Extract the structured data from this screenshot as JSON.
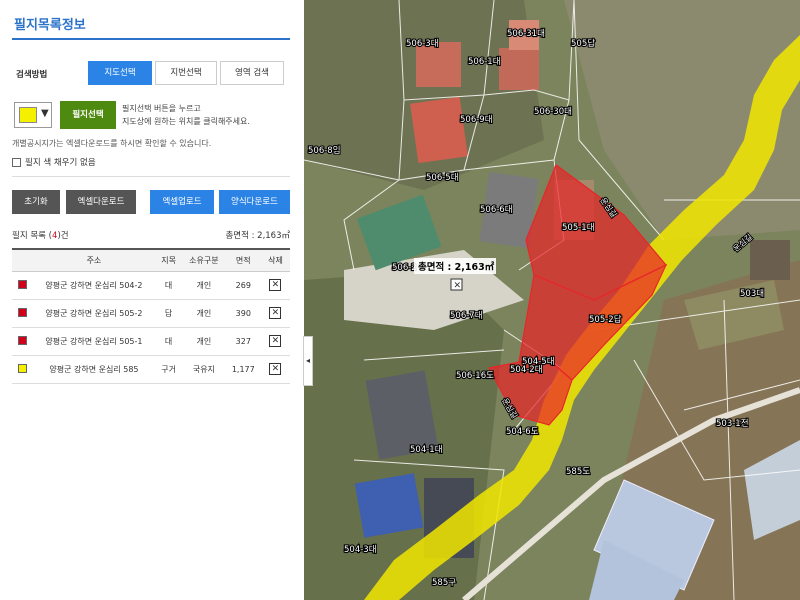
{
  "panel": {
    "title": "필지목록정보",
    "search_label": "검색방법",
    "tabs": [
      "지도선택",
      "지번선택",
      "영역 검색"
    ],
    "select_button": "필지선택",
    "help_line1": "필지선택 버튼을 누르고",
    "help_line2": "지도상에 원하는 위치를 클릭해주세요.",
    "note": "개별공시지가는 엑셀다운로드를 하시면 확인할 수 있습니다.",
    "no_fill_label": "필지 색 채우기 없음",
    "buttons": {
      "reset": "초기화",
      "excel_download": "엑셀다운로드",
      "excel_upload": "엑셀업로드",
      "form_download": "양식다운로드"
    },
    "count_prefix": "필지 목록 (",
    "count_value": "4",
    "count_suffix": ")건",
    "total_area": "총면적 : 2,163㎡",
    "table": {
      "headers": [
        "",
        "주소",
        "지목",
        "소유구분",
        "면적",
        "삭제"
      ],
      "rows": [
        {
          "color": "#d0021b",
          "address": "양평군 강하면 운심리 504-2",
          "category": "대",
          "owner": "개인",
          "area": "269"
        },
        {
          "color": "#d0021b",
          "address": "양평군 강하면 운심리 505-2",
          "category": "답",
          "owner": "개인",
          "area": "390"
        },
        {
          "color": "#d0021b",
          "address": "양평군 강하면 운심리 505-1",
          "category": "대",
          "owner": "개인",
          "area": "327"
        },
        {
          "color": "#f5f000",
          "address": "양평군 강하면 운심리 585",
          "category": "구거",
          "owner": "국유지",
          "area": "1,177"
        }
      ],
      "delete_glyph": "✕"
    },
    "handle_glyph": "◂"
  },
  "map": {
    "total_label": "총면적 : 2,163㎡",
    "parcels": [
      "506-3대",
      "506-31대",
      "506-1대",
      "505답",
      "506-30대",
      "506-9대",
      "506-8임",
      "506-5대",
      "506-6대",
      "505-1대",
      "506-2",
      "506-7대",
      "505-2답",
      "503대",
      "504-5대",
      "506-16도",
      "504-2대",
      "504-6도",
      "504-1대",
      "503-1전",
      "585도",
      "504-3대",
      "585구"
    ],
    "roads": [
      "운심길",
      "운심길",
      "운심길"
    ],
    "colors": {
      "selected": "#e8262a",
      "ditch": "#f2e600"
    }
  }
}
